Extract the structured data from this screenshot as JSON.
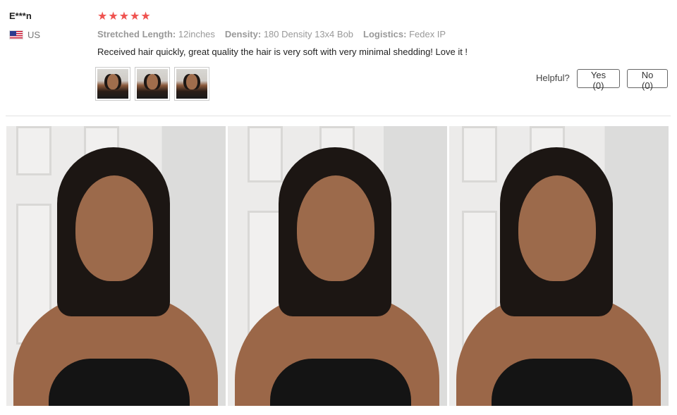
{
  "review": {
    "user_name": "E***n",
    "country": "US",
    "rating": 5,
    "stars": [
      "★",
      "★",
      "★",
      "★",
      "★"
    ],
    "star_color": "#ef5350",
    "attributes": [
      {
        "label": "Stretched Length:",
        "value": "12inches"
      },
      {
        "label": "Density:",
        "value": "180 Density 13x4 Bob"
      },
      {
        "label": "Logistics:",
        "value": "Fedex IP"
      }
    ],
    "text": "Received hair quickly, great quality the hair is very soft with very minimal shedding! Love it !",
    "helpful_label": "Helpful?",
    "yes_label": "Yes (0)",
    "no_label": "No (0)"
  }
}
